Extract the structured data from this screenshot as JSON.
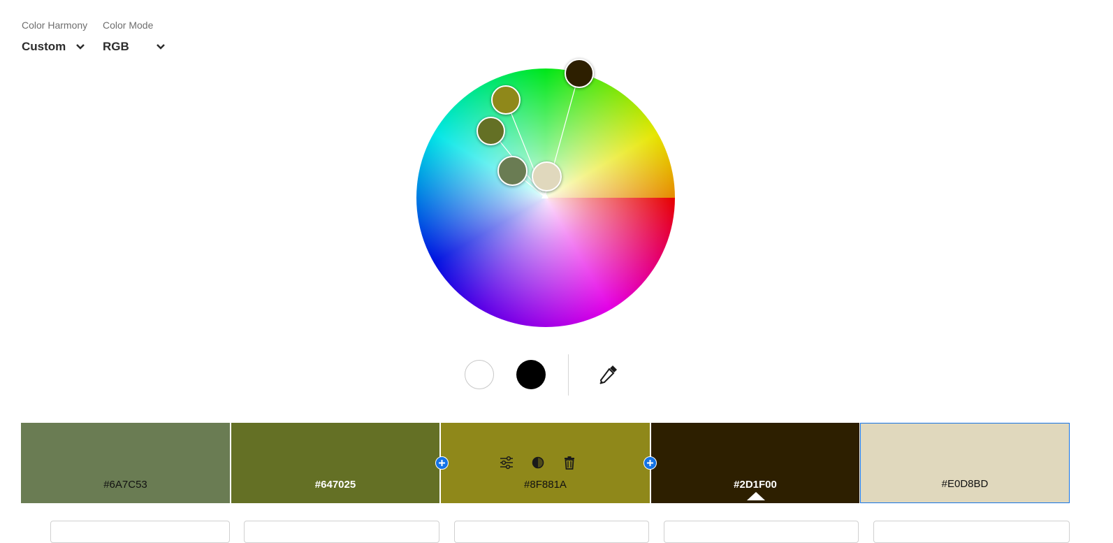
{
  "controls": {
    "harmony_label": "Color Harmony",
    "harmony_value": "Custom",
    "mode_label": "Color Mode",
    "mode_value": "RGB"
  },
  "wheel": {
    "markers": [
      "#2D1F00",
      "#8F881A",
      "#647025",
      "#6A7C53",
      "#E0D8BD"
    ]
  },
  "tools": {
    "white_icon": "white-circle-icon",
    "black_icon": "black-circle-icon",
    "eyedropper_icon": "eyedropper-icon"
  },
  "swatches": [
    {
      "hex": "#6A7C53",
      "color": "#6A7C53",
      "text_color": "#111111"
    },
    {
      "hex": "#647025",
      "color": "#647025",
      "text_color": "#ffffff"
    },
    {
      "hex": "#8F881A",
      "color": "#8F881A",
      "text_color": "#111111"
    },
    {
      "hex": "#2D1F00",
      "color": "#2D1F00",
      "text_color": "#ffffff"
    },
    {
      "hex": "#E0D8BD",
      "color": "#E0D8BD",
      "text_color": "#111111"
    }
  ],
  "active_swatch_hex": "#2D1F00",
  "selected_swatch_hex": "#E0D8BD",
  "accent_color": "#1473E6"
}
